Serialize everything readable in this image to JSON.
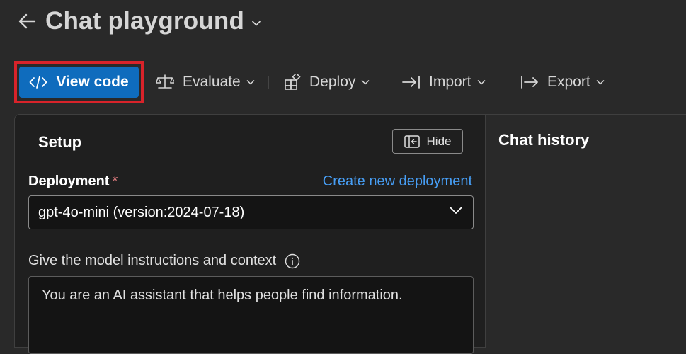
{
  "header": {
    "title": "Chat playground"
  },
  "toolbar": {
    "view_code_label": "View code",
    "evaluate_label": "Evaluate",
    "deploy_label": "Deploy",
    "import_label": "Import",
    "export_label": "Export"
  },
  "setup": {
    "title": "Setup",
    "hide_label": "Hide",
    "deployment_label": "Deployment",
    "required_mark": "*",
    "create_link": "Create new deployment",
    "deployment_value": "gpt-4o-mini (version:2024-07-18)",
    "instructions_label": "Give the model instructions and context",
    "instructions_value": "You are an AI assistant that helps people find information."
  },
  "chat": {
    "title": "Chat history"
  },
  "colors": {
    "accent": "#0f6cbd",
    "link": "#479ef5",
    "highlight": "#d8232a",
    "required": "#e37d80"
  }
}
